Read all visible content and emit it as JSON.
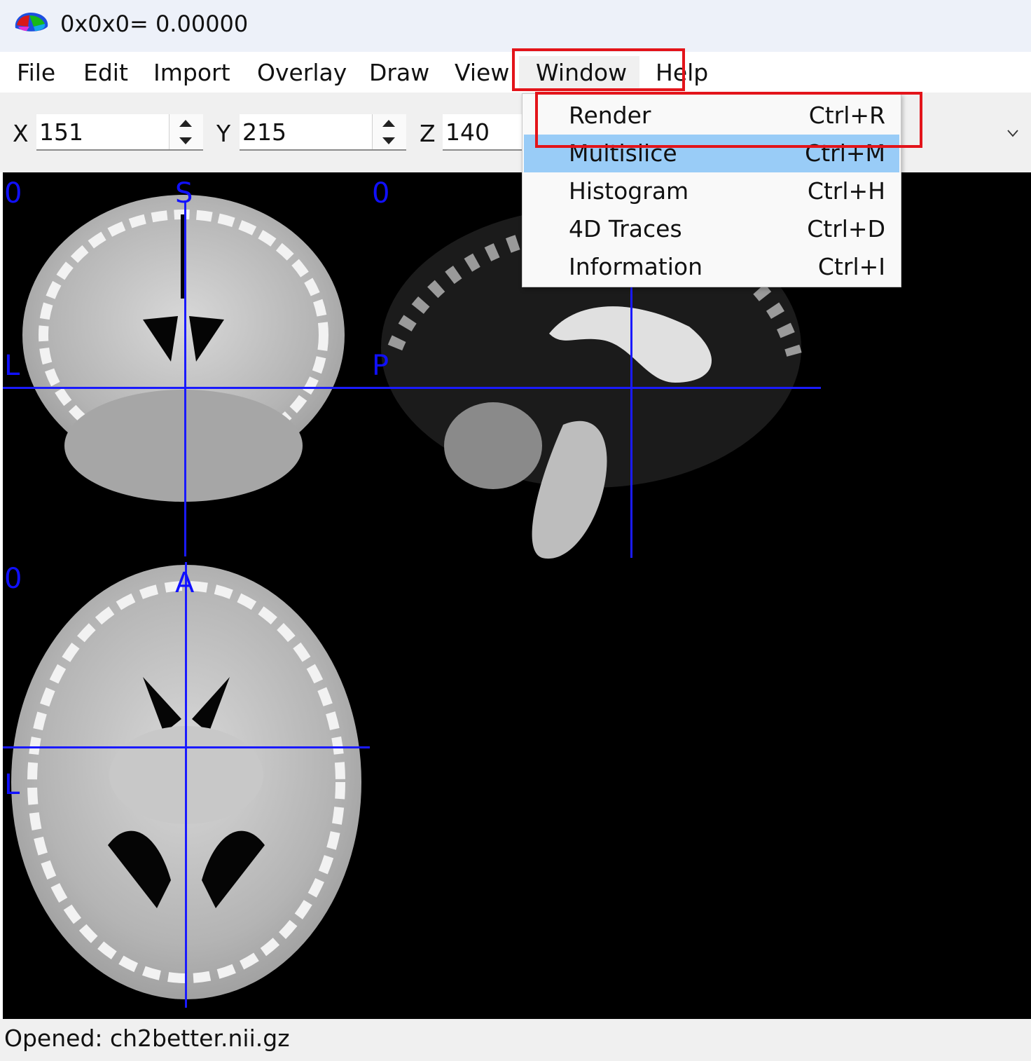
{
  "window": {
    "title": "0x0x0= 0.00000",
    "icon": "mricrogl-brain-icon"
  },
  "menubar": {
    "items": [
      {
        "label": "File"
      },
      {
        "label": "Edit"
      },
      {
        "label": "Import"
      },
      {
        "label": "Overlay"
      },
      {
        "label": "Draw"
      },
      {
        "label": "View"
      },
      {
        "label": "Window"
      },
      {
        "label": "Help"
      }
    ]
  },
  "toolbar": {
    "x_label": "X",
    "x_value": "151",
    "y_label": "Y",
    "y_value": "215",
    "z_label": "Z",
    "z_value": "140"
  },
  "window_menu": {
    "items": [
      {
        "label": "Render",
        "shortcut": "Ctrl+R"
      },
      {
        "label": "Multislice",
        "shortcut": "Ctrl+M",
        "highlighted": true
      },
      {
        "label": "Histogram",
        "shortcut": "Ctrl+H"
      },
      {
        "label": "4D Traces",
        "shortcut": "Ctrl+D"
      },
      {
        "label": "Information",
        "shortcut": "Ctrl+I"
      }
    ]
  },
  "viewer": {
    "coronal": {
      "slice_label": "0",
      "top_label": "S",
      "left_label": "L"
    },
    "sagittal": {
      "slice_label": "0",
      "left_label": "P"
    },
    "axial": {
      "slice_label": "0",
      "top_label": "A",
      "left_label": "L"
    }
  },
  "statusbar": {
    "text": "Opened: ch2better.nii.gz"
  },
  "colors": {
    "crosshair": "#1a1aff",
    "menu_highlight": "#99ccf7",
    "annotation": "#e3141a"
  }
}
